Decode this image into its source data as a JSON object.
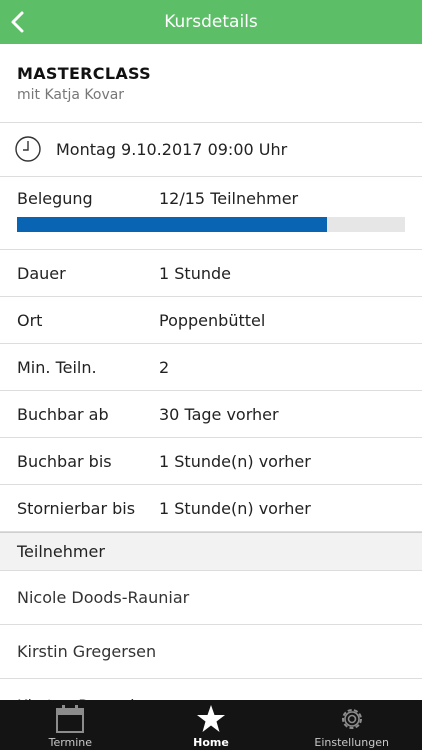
{
  "header": {
    "title": "Kursdetails"
  },
  "course": {
    "title": "MASTERCLASS",
    "trainer": "mit Katja Kovar"
  },
  "date": {
    "text": "Montag 9.10.2017 09:00 Uhr"
  },
  "occupancy": {
    "label": "Belegung",
    "value": "12/15 Teilnehmer",
    "fraction": 0.8
  },
  "details": [
    {
      "label": "Dauer",
      "value": "1 Stunde"
    },
    {
      "label": "Ort",
      "value": "Poppenbüttel"
    },
    {
      "label": "Min. Teiln.",
      "value": "2"
    },
    {
      "label": "Buchbar ab",
      "value": "30 Tage vorher"
    },
    {
      "label": "Buchbar bis",
      "value": "1 Stunde(n) vorher"
    },
    {
      "label": "Stornierbar bis",
      "value": "1 Stunde(n) vorher"
    }
  ],
  "participants": {
    "header": "Teilnehmer",
    "items": [
      "Nicole Doods-Rauniar",
      "Kirstin Gregersen",
      "Kirsten Pressel"
    ]
  },
  "tabs": [
    {
      "label": "Termine",
      "icon": "calendar-icon",
      "active": false
    },
    {
      "label": "Home",
      "icon": "star-icon",
      "active": true
    },
    {
      "label": "Einstellungen",
      "icon": "gear-icon",
      "active": false
    }
  ],
  "colors": {
    "navbar": "#5cbf67",
    "progress": "#0a64b4",
    "tabbar": "#141414"
  }
}
